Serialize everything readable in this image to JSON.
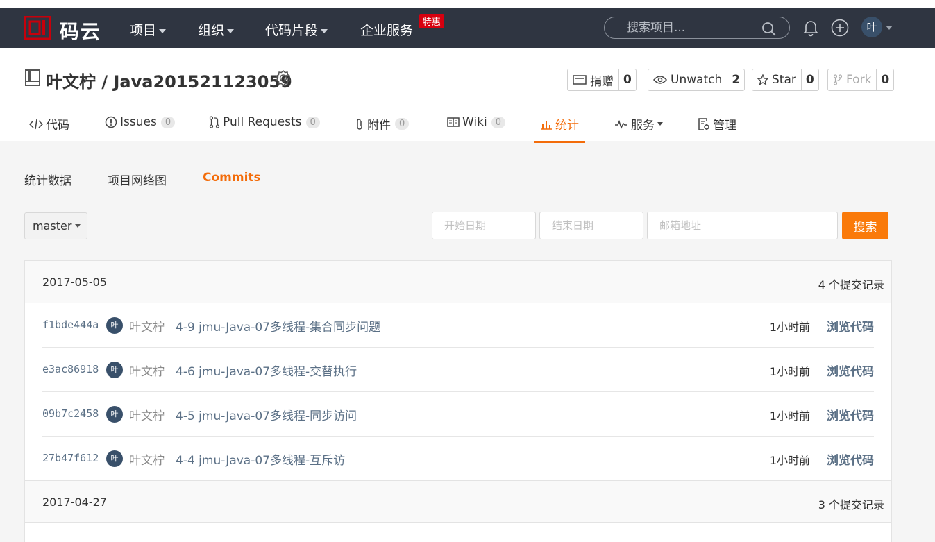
{
  "brand": {
    "logo_text": "码云",
    "accent": "#c7000b",
    "nav_bg": "#2f3541"
  },
  "nav": {
    "items": [
      {
        "label": "项目"
      },
      {
        "label": "组织"
      },
      {
        "label": "代码片段"
      },
      {
        "label": "企业服务"
      }
    ],
    "special_badge": "特惠",
    "search_placeholder": "搜索项目...",
    "avatar": "叶",
    "icons": [
      "search-icon",
      "bell-icon",
      "plus-circle-icon",
      "chevron-down-icon"
    ]
  },
  "repo": {
    "title": "叶文柠 / Java201521123059",
    "donate": {
      "label": "捐赠",
      "count": "0"
    },
    "watch": {
      "label": "Unwatch",
      "count": "2"
    },
    "star": {
      "label": "Star",
      "count": "0"
    },
    "fork": {
      "label": "Fork",
      "count": "0"
    }
  },
  "tabs": [
    {
      "label": "代码",
      "count": ""
    },
    {
      "label": "Issues",
      "count": "0"
    },
    {
      "label": "Pull Requests",
      "count": "0"
    },
    {
      "label": "附件",
      "count": "0"
    },
    {
      "label": "Wiki",
      "count": "0"
    },
    {
      "label": "统计",
      "count": "",
      "active": true
    },
    {
      "label": "服务",
      "count": ""
    },
    {
      "label": "管理",
      "count": ""
    }
  ],
  "subnav": [
    {
      "label": "统计数据"
    },
    {
      "label": "项目网络图"
    },
    {
      "label": "Commits",
      "active": true
    }
  ],
  "filters": {
    "branch": "master",
    "start_placeholder": "开始日期",
    "end_placeholder": "结束日期",
    "email_placeholder": "邮箱地址",
    "search_label": "搜索"
  },
  "commit_groups": [
    {
      "date": "2017-05-05",
      "count_label": "4 个提交记录",
      "commits": [
        {
          "sha": "f1bde444a",
          "avatar": "叶",
          "author": "叶文柠",
          "message": "4-9 jmu-Java-07多线程-集合同步问题",
          "time": "1小时前",
          "browse": "浏览代码"
        },
        {
          "sha": "e3ac86918",
          "avatar": "叶",
          "author": "叶文柠",
          "message": "4-6 jmu-Java-07多线程-交替执行",
          "time": "1小时前",
          "browse": "浏览代码"
        },
        {
          "sha": "09b7c2458",
          "avatar": "叶",
          "author": "叶文柠",
          "message": "4-5 jmu-Java-07多线程-同步访问",
          "time": "1小时前",
          "browse": "浏览代码"
        },
        {
          "sha": "27b47f612",
          "avatar": "叶",
          "author": "叶文柠",
          "message": "4-4 jmu-Java-07多线程-互斥访",
          "time": "1小时前",
          "browse": "浏览代码"
        }
      ]
    },
    {
      "date": "2017-04-27",
      "count_label": "3 个提交记录",
      "commits": []
    }
  ]
}
